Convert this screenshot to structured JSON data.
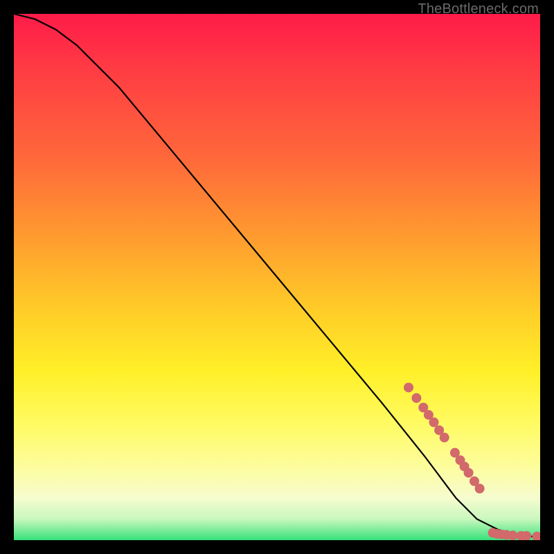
{
  "watermark": "TheBottleneck.com",
  "chart_data": {
    "type": "line",
    "title": "",
    "xlabel": "",
    "ylabel": "",
    "xlim": [
      0,
      100
    ],
    "ylim": [
      0,
      100
    ],
    "series": [
      {
        "name": "curve",
        "color": "#000000",
        "x": [
          0,
          4,
          8,
          12,
          20,
          30,
          40,
          50,
          60,
          70,
          78,
          84,
          88,
          92,
          96,
          100
        ],
        "y": [
          100,
          99,
          97,
          94,
          86,
          74,
          62,
          50,
          38,
          26,
          16,
          8,
          4,
          2,
          1,
          0.5
        ]
      }
    ],
    "scatter": {
      "name": "dots",
      "color": "#d2696b",
      "radius": 7,
      "points": [
        {
          "x": 75.0,
          "y": 29.0
        },
        {
          "x": 76.5,
          "y": 27.0
        },
        {
          "x": 77.8,
          "y": 25.2
        },
        {
          "x": 78.8,
          "y": 23.8
        },
        {
          "x": 79.8,
          "y": 22.4
        },
        {
          "x": 80.8,
          "y": 20.9
        },
        {
          "x": 81.8,
          "y": 19.5
        },
        {
          "x": 83.8,
          "y": 16.6
        },
        {
          "x": 84.8,
          "y": 15.2
        },
        {
          "x": 85.6,
          "y": 14.0
        },
        {
          "x": 86.4,
          "y": 12.8
        },
        {
          "x": 87.5,
          "y": 11.2
        },
        {
          "x": 88.5,
          "y": 9.8
        },
        {
          "x": 91.0,
          "y": 1.4
        },
        {
          "x": 91.8,
          "y": 1.2
        },
        {
          "x": 92.6,
          "y": 1.1
        },
        {
          "x": 93.6,
          "y": 1.0
        },
        {
          "x": 94.8,
          "y": 0.9
        },
        {
          "x": 96.4,
          "y": 0.8
        },
        {
          "x": 97.4,
          "y": 0.8
        },
        {
          "x": 99.4,
          "y": 0.7
        }
      ]
    }
  }
}
